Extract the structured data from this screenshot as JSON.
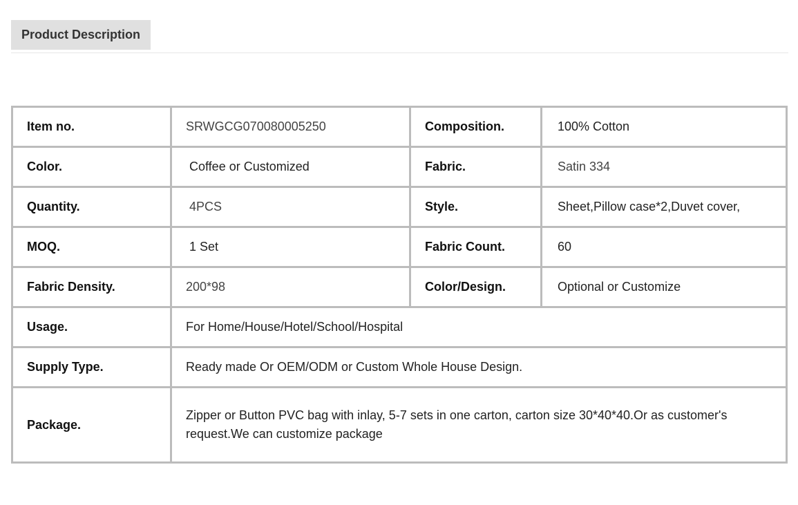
{
  "header": {
    "tab_label": "Product Description"
  },
  "specs": {
    "item_no_label": "Item no.",
    "item_no_value": "SRWGCG070080005250",
    "composition_label": "Composition.",
    "composition_value": "100% Cotton",
    "color_label": "Color.",
    "color_value": "Coffee or Customized",
    "fabric_label": "Fabric.",
    "fabric_value": "Satin 334",
    "quantity_label": "Quantity.",
    "quantity_value": "4PCS",
    "style_label": "Style.",
    "style_value": "Sheet,Pillow case*2,Duvet cover,",
    "moq_label": "MOQ.",
    "moq_value": "1 Set",
    "fabric_count_label": "Fabric Count.",
    "fabric_count_value": "60",
    "fabric_density_label": "Fabric Density.",
    "fabric_density_value": "200*98",
    "color_design_label": "Color/Design.",
    "color_design_value": "Optional or Customize",
    "usage_label": "Usage.",
    "usage_value": "For Home/House/Hotel/School/Hospital",
    "supply_type_label": "Supply Type.",
    "supply_type_value": "Ready made Or OEM/ODM or Custom Whole House Design.",
    "package_label": "Package.",
    "package_value": "Zipper or Button PVC bag with inlay, 5-7 sets in one carton, carton size 30*40*40.Or as customer's request.We can customize package"
  },
  "colors": {
    "tab_background": "#e0e0e0",
    "table_border": "#bcbcbc"
  }
}
